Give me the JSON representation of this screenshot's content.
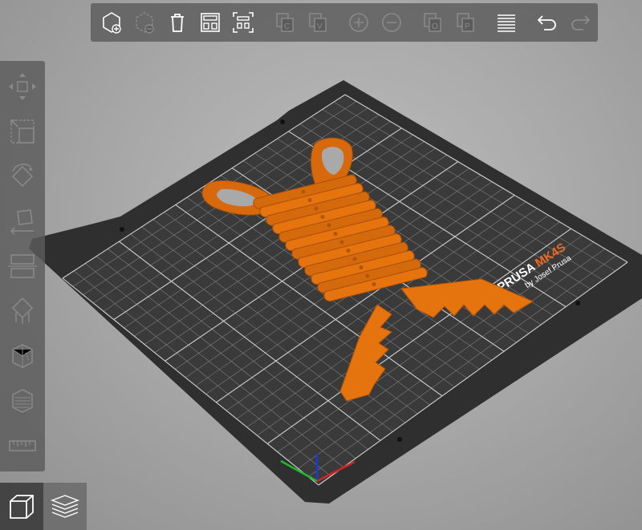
{
  "bed": {
    "brand": "PRUSA",
    "model": "MK4S",
    "maker": "by Josef Prusa",
    "accent_color": "#ED6B21",
    "bed_color": "#2f2f2f",
    "model_color": "#E5730E"
  },
  "top_toolbar": {
    "buttons": [
      {
        "icon": "add-object-icon",
        "enabled": true
      },
      {
        "icon": "delete-icon",
        "enabled": false
      },
      {
        "icon": "delete-all-icon",
        "enabled": true
      },
      {
        "icon": "arrange-icon",
        "enabled": true
      },
      {
        "icon": "arrange-selection-icon",
        "enabled": true
      },
      {
        "icon": "copy-icon",
        "enabled": false
      },
      {
        "icon": "paste-icon",
        "enabled": false
      },
      {
        "icon": "add-instance-icon",
        "enabled": false
      },
      {
        "icon": "remove-instance-icon",
        "enabled": false
      },
      {
        "icon": "split-objects-icon",
        "enabled": false
      },
      {
        "icon": "split-parts-icon",
        "enabled": false
      },
      {
        "icon": "layer-editing-icon",
        "enabled": true
      },
      {
        "icon": "undo-icon",
        "enabled": true
      },
      {
        "icon": "redo-icon",
        "enabled": false
      }
    ]
  },
  "left_toolbar": {
    "tools": [
      {
        "icon": "move-icon"
      },
      {
        "icon": "scale-icon"
      },
      {
        "icon": "rotate-icon"
      },
      {
        "icon": "place-on-face-icon"
      },
      {
        "icon": "cut-icon"
      },
      {
        "icon": "paint-supports-icon"
      },
      {
        "icon": "seam-painting-icon"
      },
      {
        "icon": "measure-icon"
      },
      {
        "icon": "ruler-icon"
      }
    ]
  },
  "view_switcher": [
    {
      "icon": "3d-view-icon",
      "active": true
    },
    {
      "icon": "preview-layers-icon",
      "active": false
    }
  ]
}
